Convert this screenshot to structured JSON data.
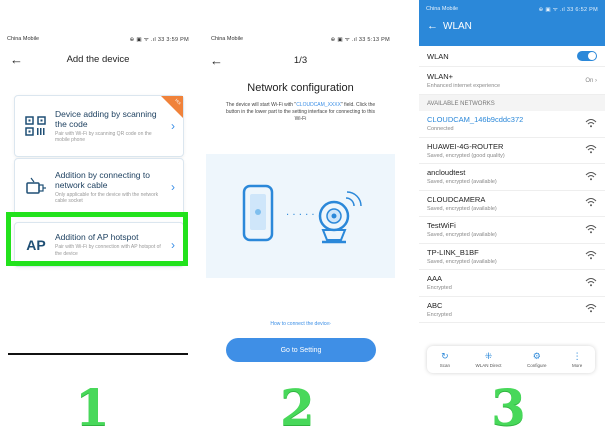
{
  "panel1": {
    "carrier": "China Mobile",
    "status_right": "⊕ ▣ ᯤ .ıl 33 3:59 PM",
    "title": "Add the device",
    "cards": [
      {
        "title": "Device adding by scanning the code",
        "desc": "Pair with Wi-Fi by scanning QR code on the mobile phone",
        "badge": "Hot"
      },
      {
        "title": "Addition by connecting to network cable",
        "desc": "Only applicable for the device with the network cable socket"
      },
      {
        "title": "Addition of AP hotspot",
        "desc": "Pair with Wi-Fi by connection with AP hotspot of the device",
        "icon_text": "AP"
      }
    ]
  },
  "panel2": {
    "carrier": "China Mobile",
    "status_right": "⊕ ▣ ᯤ .ıl 33 5:13 PM",
    "step": "1/3",
    "title": "Network configuration",
    "desc_before": "The device will start Wi-Fi with \"",
    "desc_highlight": "CLOUDCAM_XXXX",
    "desc_after": "\" field. Click the button in the lower part to the setting interface for connecting to this Wi-Fi",
    "dots": "· · · · ·",
    "link": "How to connect the device›",
    "button": "Go to Setting"
  },
  "panel3": {
    "carrier": "China Mobile",
    "status_right": "⊕ ▣ ᯤ .ıl 33 6:52 PM",
    "title": "WLAN",
    "wlan_label": "WLAN",
    "wlan_plus_label": "WLAN+",
    "wlan_plus_sub": "Enhanced internet experience",
    "wlan_plus_value": "On ›",
    "section": "AVAILABLE NETWORKS",
    "networks": [
      {
        "name": "CLOUDCAM_146b9cddc372",
        "status": "Connected"
      },
      {
        "name": "HUAWEI-4G-ROUTER",
        "status": "Saved, encrypted (good quality)"
      },
      {
        "name": "ancloudtest",
        "status": "Saved, encrypted (available)"
      },
      {
        "name": "CLOUDCAMERA",
        "status": "Saved, encrypted (available)"
      },
      {
        "name": "TestWiFi",
        "status": "Saved, encrypted (available)"
      },
      {
        "name": "TP-LINK_B1BF",
        "status": "Saved, encrypted (available)"
      },
      {
        "name": "AAA",
        "status": "Encrypted"
      },
      {
        "name": "ABC",
        "status": "Encrypted"
      }
    ],
    "bottom_bar": [
      {
        "label": "Scan",
        "icon": "↻"
      },
      {
        "label": "WLAN Direct",
        "icon": "⁜"
      },
      {
        "label": "Configure",
        "icon": "⚙"
      },
      {
        "label": "More",
        "icon": "⋮"
      }
    ]
  },
  "step_numbers": [
    "1",
    "2",
    "3"
  ],
  "colors": {
    "highlight": "#22e21c",
    "accent": "#3a8ee6",
    "wlan_header": "#2b88d9",
    "badge": "#f0823a",
    "numbers": "#48d85a"
  }
}
